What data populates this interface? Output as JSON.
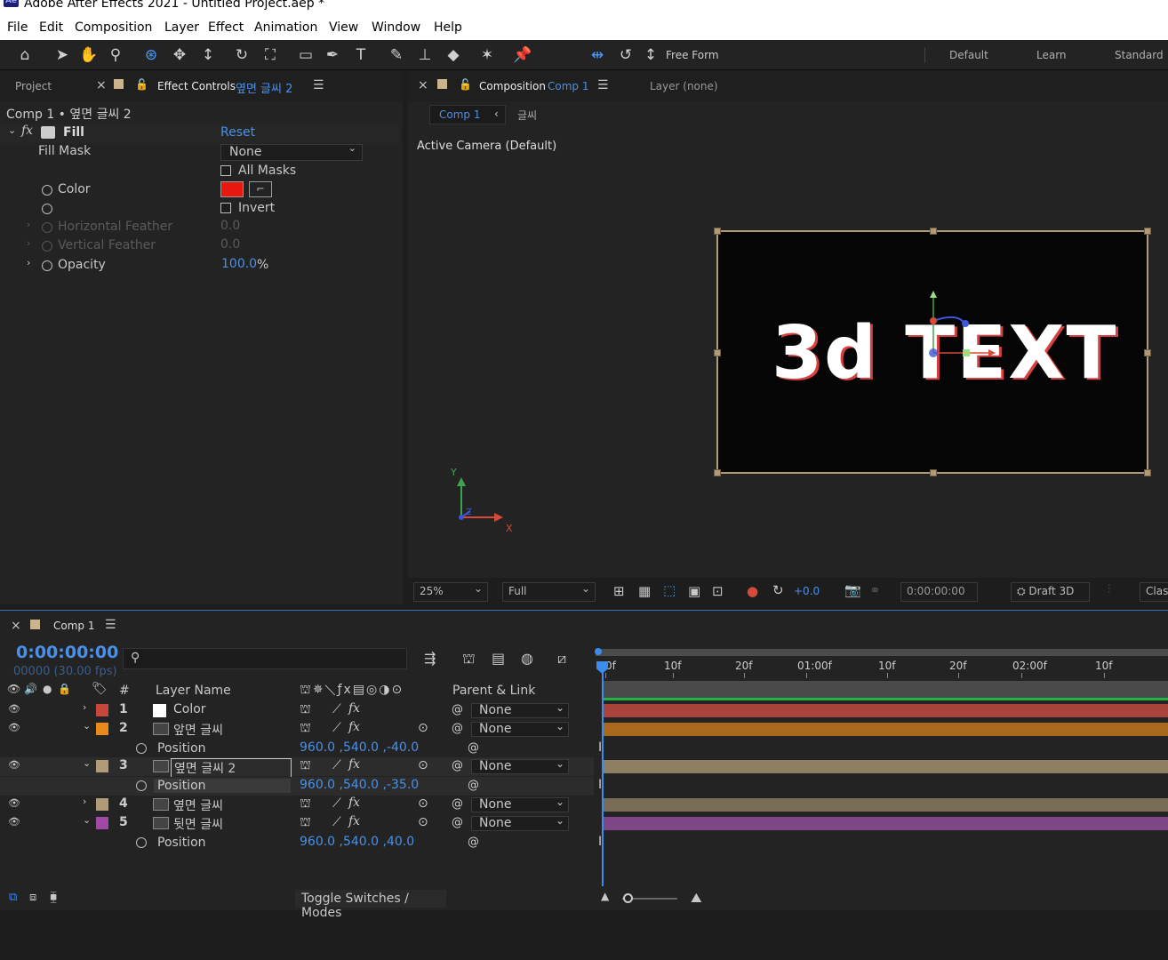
{
  "app": {
    "logo": "Ae",
    "title": "Adobe After Effects 2021 - Untitled Project.aep *"
  },
  "menu": [
    "File",
    "Edit",
    "Composition",
    "Layer",
    "Effect",
    "Animation",
    "View",
    "Window",
    "Help"
  ],
  "toolbar": {
    "free_form": "Free Form",
    "workspaces": [
      "Default",
      "Learn",
      "Standard"
    ]
  },
  "effect_panel": {
    "project_tab": "Project",
    "tab_label": "Effect Controls",
    "tab_layer": "옆면 글씨 2",
    "breadcrumb": "Comp 1 • 옆면 글씨 2",
    "effect_name": "Fill",
    "reset": "Reset",
    "fill_mask_label": "Fill Mask",
    "fill_mask_value": "None",
    "all_masks": "All Masks",
    "color_label": "Color",
    "color_value": "#e8170f",
    "invert": "Invert",
    "h_feather": "Horizontal Feather",
    "h_feather_val": "0.0",
    "v_feather": "Vertical Feather",
    "v_feather_val": "0.0",
    "opacity": "Opacity",
    "opacity_val": "100.0",
    "opacity_unit": "%"
  },
  "comp_panel": {
    "tab_label": "Composition",
    "tab_comp": "Comp 1",
    "layer_tab": "Layer (none)",
    "crumb_comp": "Comp 1",
    "crumb_layer": "글씨",
    "camera": "Active Camera (Default)",
    "render_text": "3d TEXT",
    "axis_y": "Y",
    "axis_z": "Z",
    "axis_x": "X",
    "zoom": "25%",
    "resolution": "Full",
    "exposure": "+0.0",
    "timecode": "0:00:00:00",
    "renderer": "Draft 3D",
    "classic": "Class"
  },
  "timeline": {
    "comp_tab": "Comp 1",
    "timecode": "0:00:00:00",
    "frames": "00000 (30.00 fps)",
    "col_layer_name": "Layer Name",
    "col_num": "#",
    "col_parent": "Parent & Link",
    "ruler": [
      "0f",
      "10f",
      "20f",
      "01:00f",
      "10f",
      "20f",
      "02:00f",
      "10f"
    ],
    "layers": [
      {
        "num": "1",
        "name": "Color",
        "color": "#c8473d",
        "track": "#a8443c",
        "parent": "None"
      },
      {
        "num": "2",
        "name": "앞면 글씨",
        "color": "#e88a1a",
        "track": "#a8681e",
        "parent": "None",
        "prop": "Position",
        "val": "960.0 ,540.0 ,-40.0"
      },
      {
        "num": "3",
        "name": "옆면 글씨 2",
        "color": "#b09a78",
        "track": "#8e7e62",
        "parent": "None",
        "prop": "Position",
        "val": "960.0 ,540.0 ,-35.0"
      },
      {
        "num": "4",
        "name": "옆면 글씨",
        "color": "#b09a78",
        "track": "#7a6d58",
        "parent": "None"
      },
      {
        "num": "5",
        "name": "뒷면 글씨",
        "color": "#a04aa8",
        "track": "#7e4686",
        "parent": "None",
        "prop": "Position",
        "val": "960.0 ,540.0 ,40.0"
      }
    ],
    "toggle": "Toggle Switches / Modes"
  }
}
